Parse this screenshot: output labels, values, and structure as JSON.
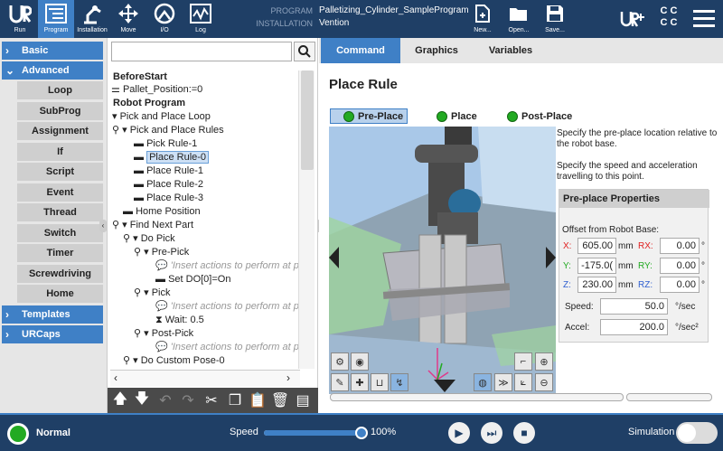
{
  "header": {
    "nav": [
      {
        "label": "Run",
        "icon": "ur-logo-icon"
      },
      {
        "label": "Program",
        "icon": "program-icon"
      },
      {
        "label": "Installation",
        "icon": "installation-icon"
      },
      {
        "label": "Move",
        "icon": "move-icon"
      },
      {
        "label": "I/O",
        "icon": "io-icon"
      },
      {
        "label": "Log",
        "icon": "log-icon"
      }
    ],
    "program_key": "PROGRAM",
    "program_value": "Palletizing_Cylinder_SampleProgram",
    "installation_key": "INSTALLATION",
    "installation_value": "Vention",
    "file_buttons": [
      {
        "label": "New...",
        "icon": "new-file-icon"
      },
      {
        "label": "Open...",
        "icon": "open-folder-icon"
      },
      {
        "label": "Save...",
        "icon": "save-icon"
      }
    ]
  },
  "leftnav": {
    "basic": "Basic",
    "advanced": "Advanced",
    "advanced_items": [
      "Loop",
      "SubProg",
      "Assignment",
      "If",
      "Script",
      "Event",
      "Thread",
      "Switch",
      "Timer",
      "Screwdriving",
      "Home"
    ],
    "templates": "Templates",
    "urcaps": "URCaps"
  },
  "tree": {
    "lines": [
      "BeforeStart",
      "Pallet_Position:=0",
      "Robot Program",
      "Pick and Place Loop",
      "Pick and Place Rules",
      "Pick Rule-1",
      "Place Rule-0",
      "Place Rule-1",
      "Place Rule-2",
      "Place Rule-3",
      "Home Position",
      "Find Next Part",
      "Do Pick",
      "Pre-Pick",
      "'Insert actions to perform at p",
      "Set DO[0]=On",
      "Pick",
      "'Insert actions to perform at p",
      "Wait: 0.5",
      "Post-Pick",
      "'Insert actions to perform at p",
      "Do Custom Pose-0"
    ]
  },
  "tabs": [
    "Command",
    "Graphics",
    "Variables"
  ],
  "command": {
    "title": "Place Rule",
    "waypoints": [
      "Pre-Place",
      "Place",
      "Post-Place"
    ],
    "desc1": "Specify the pre-place location relative to the robot base.",
    "desc2": "Specify the speed and acceleration travelling to this point.",
    "props_title": "Pre-place Properties",
    "offset_label": "Offset from Robot Base:",
    "x_label": "X:",
    "x_value": "605.00",
    "x_unit": "mm",
    "rx_label": "RX:",
    "rx_value": "0.00",
    "rx_unit": "°",
    "y_label": "Y:",
    "y_value": "-175.0(",
    "y_unit": "mm",
    "ry_label": "RY:",
    "ry_value": "0.00",
    "ry_unit": "°",
    "z_label": "Z:",
    "z_value": "230.00",
    "z_unit": "mm",
    "rz_label": "RZ:",
    "rz_value": "0.00",
    "rz_unit": "°",
    "speed_label": "Speed:",
    "speed_value": "50.0",
    "speed_unit": "°/sec",
    "accel_label": "Accel:",
    "accel_value": "200.0",
    "accel_unit": "°/sec²"
  },
  "footer": {
    "status": "Normal",
    "speed_label": "Speed",
    "speed_value": "100%",
    "speed_fraction": 1.0,
    "simulation_label": "Simulation"
  },
  "colors": {
    "header_bg": "#1f3f66",
    "accent": "#3f80c6",
    "status_green": "#22aa22"
  }
}
